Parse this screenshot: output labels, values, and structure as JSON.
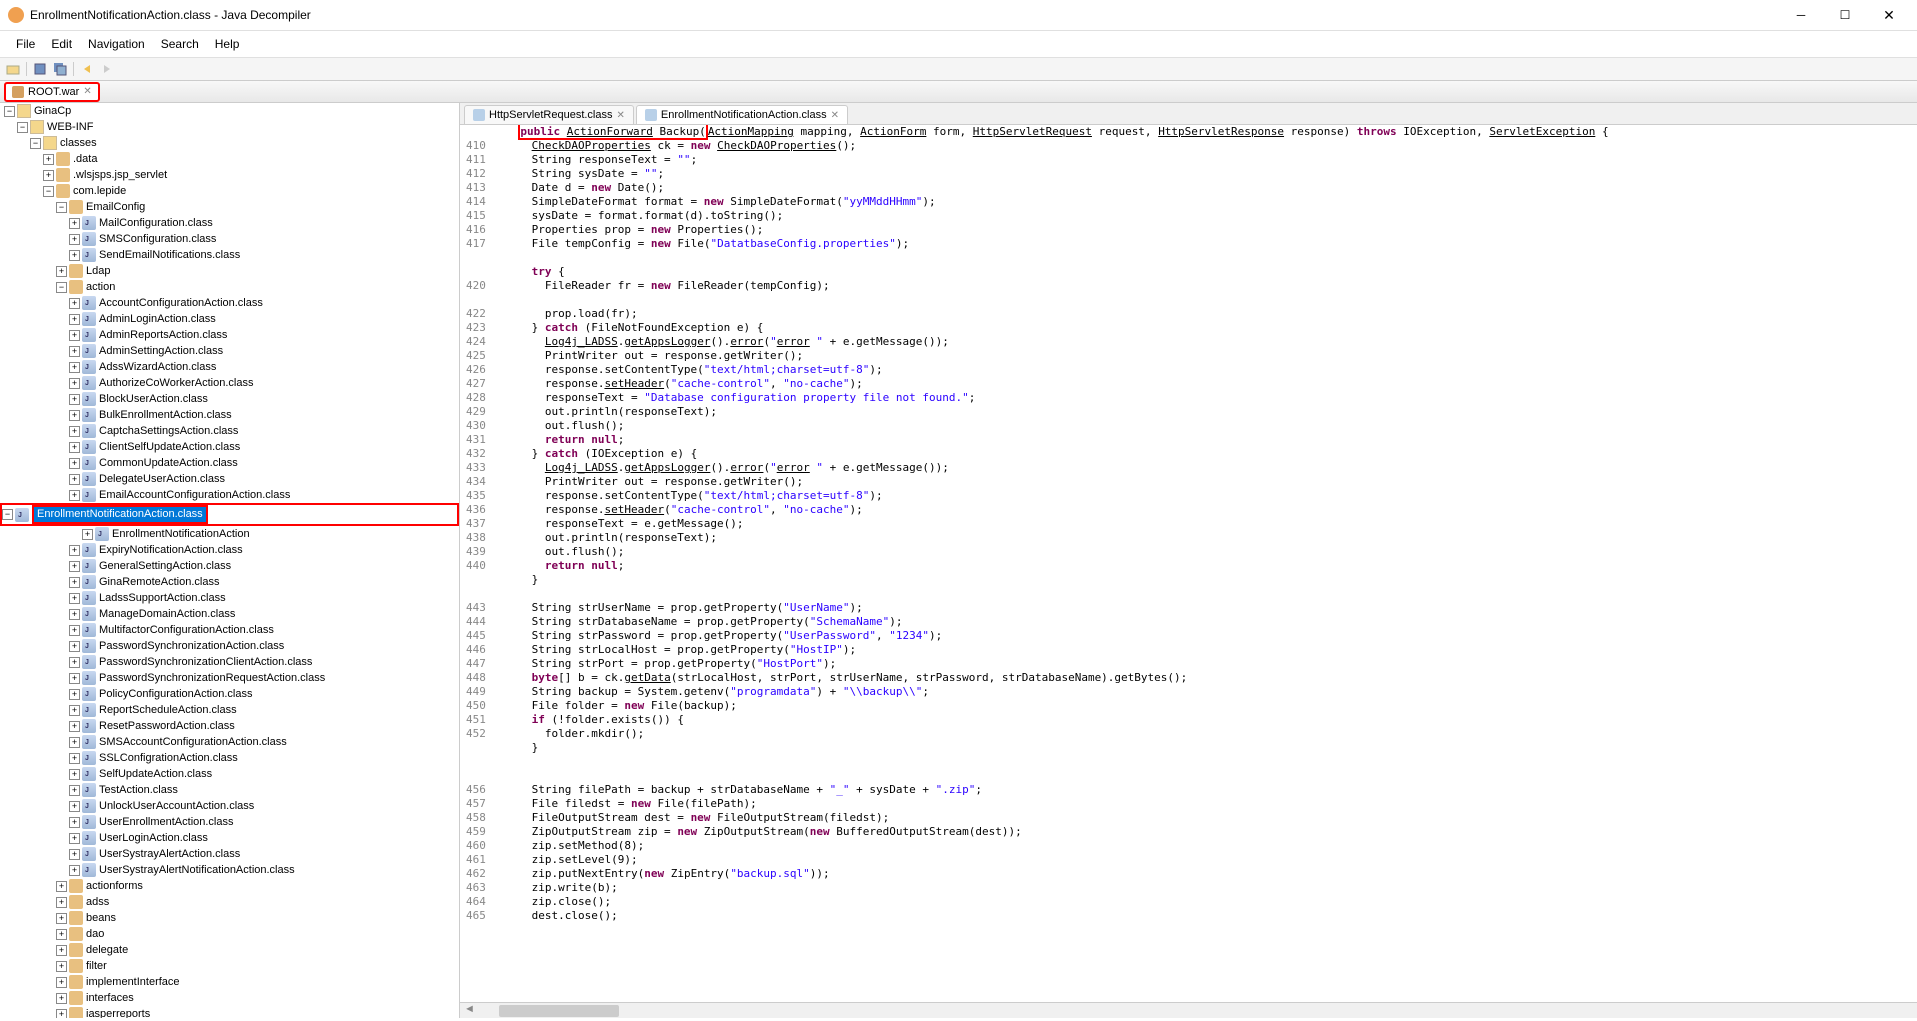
{
  "window": {
    "title": "EnrollmentNotificationAction.class - Java Decompiler"
  },
  "menubar": [
    "File",
    "Edit",
    "Navigation",
    "Search",
    "Help"
  ],
  "tab": {
    "label": "ROOT.war"
  },
  "tree": {
    "root": "GinaCp",
    "webinf": "WEB-INF",
    "classes": "classes",
    "data": ".data",
    "wlsjsps": ".wlsjsps.jsp_servlet",
    "comlepide": "com.lepide",
    "emailconfig": "EmailConfig",
    "emailconfig_items": [
      "MailConfiguration.class",
      "SMSConfiguration.class",
      "SendEmailNotifications.class"
    ],
    "ldap": "Ldap",
    "action": "action",
    "action_items": [
      "AccountConfigurationAction.class",
      "AdminLoginAction.class",
      "AdminReportsAction.class",
      "AdminSettingAction.class",
      "AdssWizardAction.class",
      "AuthorizeCoWorkerAction.class",
      "BlockUserAction.class",
      "BulkEnrollmentAction.class",
      "CaptchaSettingsAction.class",
      "ClientSelfUpdateAction.class",
      "CommonUpdateAction.class",
      "DelegateUserAction.class",
      "EmailAccountConfigurationAction.class",
      "EnrollmentNotificationAction.class",
      "EnrollmentNotificationAction",
      "ExpiryNotificationAction.class",
      "GeneralSettingAction.class",
      "GinaRemoteAction.class",
      "LadssSupportAction.class",
      "ManageDomainAction.class",
      "MultifactorConfigurationAction.class",
      "PasswordSynchronizationAction.class",
      "PasswordSynchronizationClientAction.class",
      "PasswordSynchronizationRequestAction.class",
      "PolicyConfigurationAction.class",
      "ReportScheduleAction.class",
      "ResetPasswordAction.class",
      "SMSAccountConfigurationAction.class",
      "SSLConfigrationAction.class",
      "SelfUpdateAction.class",
      "TestAction.class",
      "UnlockUserAccountAction.class",
      "UserEnrollmentAction.class",
      "UserLoginAction.class",
      "UserSystrayAlertAction.class",
      "UserSystrayAlertNotificationAction.class"
    ],
    "siblings": [
      "actionforms",
      "adss",
      "beans",
      "dao",
      "delegate",
      "filter",
      "implementInterface",
      "interfaces",
      "iasperreports"
    ]
  },
  "editor_tabs": [
    {
      "label": "HttpServletRequest.class"
    },
    {
      "label": "EnrollmentNotificationAction.class"
    }
  ],
  "code": {
    "sig_pre": "public ",
    "sig_fw": "ActionForward",
    "sig_name": " Backup(",
    "sig_rest_1": "ActionMapping",
    "sig_rest_2": " mapping, ",
    "sig_rest_3": "ActionForm",
    "sig_rest_4": " form, ",
    "sig_rest_5": "HttpServletRequest",
    "sig_rest_6": " request, ",
    "sig_rest_7": "HttpServletResponse",
    "sig_rest_8": " response) ",
    "sig_throws": "throws",
    "sig_exc": " IOException, ",
    "sig_exc2": "ServletException",
    "sig_brace": " {",
    "lines": {
      "409": "",
      "410": "      CheckDAOProperties ck = new CheckDAOProperties();",
      "411": "      String responseText = \"\";",
      "412": "      String sysDate = \"\";",
      "413": "      Date d = new Date();",
      "414": "      SimpleDateFormat format = new SimpleDateFormat(\"yyMMddHHmm\");",
      "415": "      sysDate = format.format(d).toString();",
      "416": "      Properties prop = new Properties();",
      "417": "      File tempConfig = new File(\"DatatbaseConfig.properties\");",
      "418": "",
      "419": "      try {",
      "420": "        FileReader fr = new FileReader(tempConfig);",
      "421": "",
      "422": "        prop.load(fr);",
      "423": "      } catch (FileNotFoundException e) {",
      "424": "        Log4j_LADSS.getAppsLogger().error(\"error \" + e.getMessage());",
      "425": "        PrintWriter out = response.getWriter();",
      "426": "        response.setContentType(\"text/html;charset=utf-8\");",
      "427": "        response.setHeader(\"cache-control\", \"no-cache\");",
      "428": "        responseText = \"Database configuration property file not found.\";",
      "429": "        out.println(responseText);",
      "430": "        out.flush();",
      "431": "        return null;",
      "432": "      } catch (IOException e) {",
      "433": "        Log4j_LADSS.getAppsLogger().error(\"error \" + e.getMessage());",
      "434": "        PrintWriter out = response.getWriter();",
      "435": "        response.setContentType(\"text/html;charset=utf-8\");",
      "436": "        response.setHeader(\"cache-control\", \"no-cache\");",
      "437": "        responseText = e.getMessage();",
      "438": "        out.println(responseText);",
      "439": "        out.flush();",
      "440": "        return null;",
      "441": "      }",
      "442": "",
      "443": "      String strUserName = prop.getProperty(\"UserName\");",
      "444": "      String strDatabaseName = prop.getProperty(\"SchemaName\");",
      "445": "      String strPassword = prop.getProperty(\"UserPassword\", \"1234\");",
      "446": "      String strLocalHost = prop.getProperty(\"HostIP\");",
      "447": "      String strPort = prop.getProperty(\"HostPort\");",
      "448": "      byte[] b = ck.getData(strLocalHost, strPort, strUserName, strPassword, strDatabaseName).getBytes();",
      "449": "      String backup = System.getenv(\"programdata\") + \"\\\\backup\\\\\";",
      "450": "      File folder = new File(backup);",
      "451": "      if (!folder.exists()) {",
      "452": "        folder.mkdir();",
      "453": "      }",
      "454": "",
      "455": "",
      "456": "      String filePath = backup + strDatabaseName + \"_\" + sysDate + \".zip\";",
      "457": "      File filedst = new File(filePath);",
      "458": "      FileOutputStream dest = new FileOutputStream(filedst);",
      "459": "      ZipOutputStream zip = new ZipOutputStream(new BufferedOutputStream(dest));",
      "460": "      zip.setMethod(8);",
      "461": "      zip.setLevel(9);",
      "462": "      zip.putNextEntry(new ZipEntry(\"backup.sql\"));",
      "463": "      zip.write(b);",
      "464": "      zip.close();",
      "465": "      dest.close();"
    },
    "line_numbers": [
      "",
      "410",
      "411",
      "412",
      "413",
      "414",
      "415",
      "416",
      "417",
      "",
      "",
      "420",
      "",
      "422",
      "423",
      "424",
      "425",
      "426",
      "427",
      "428",
      "429",
      "430",
      "431",
      "432",
      "433",
      "434",
      "435",
      "436",
      "437",
      "438",
      "439",
      "440",
      "",
      "",
      "443",
      "444",
      "445",
      "446",
      "447",
      "448",
      "449",
      "450",
      "451",
      "452",
      "",
      "",
      "",
      "456",
      "457",
      "458",
      "459",
      "460",
      "461",
      "462",
      "463",
      "464",
      "465"
    ]
  }
}
